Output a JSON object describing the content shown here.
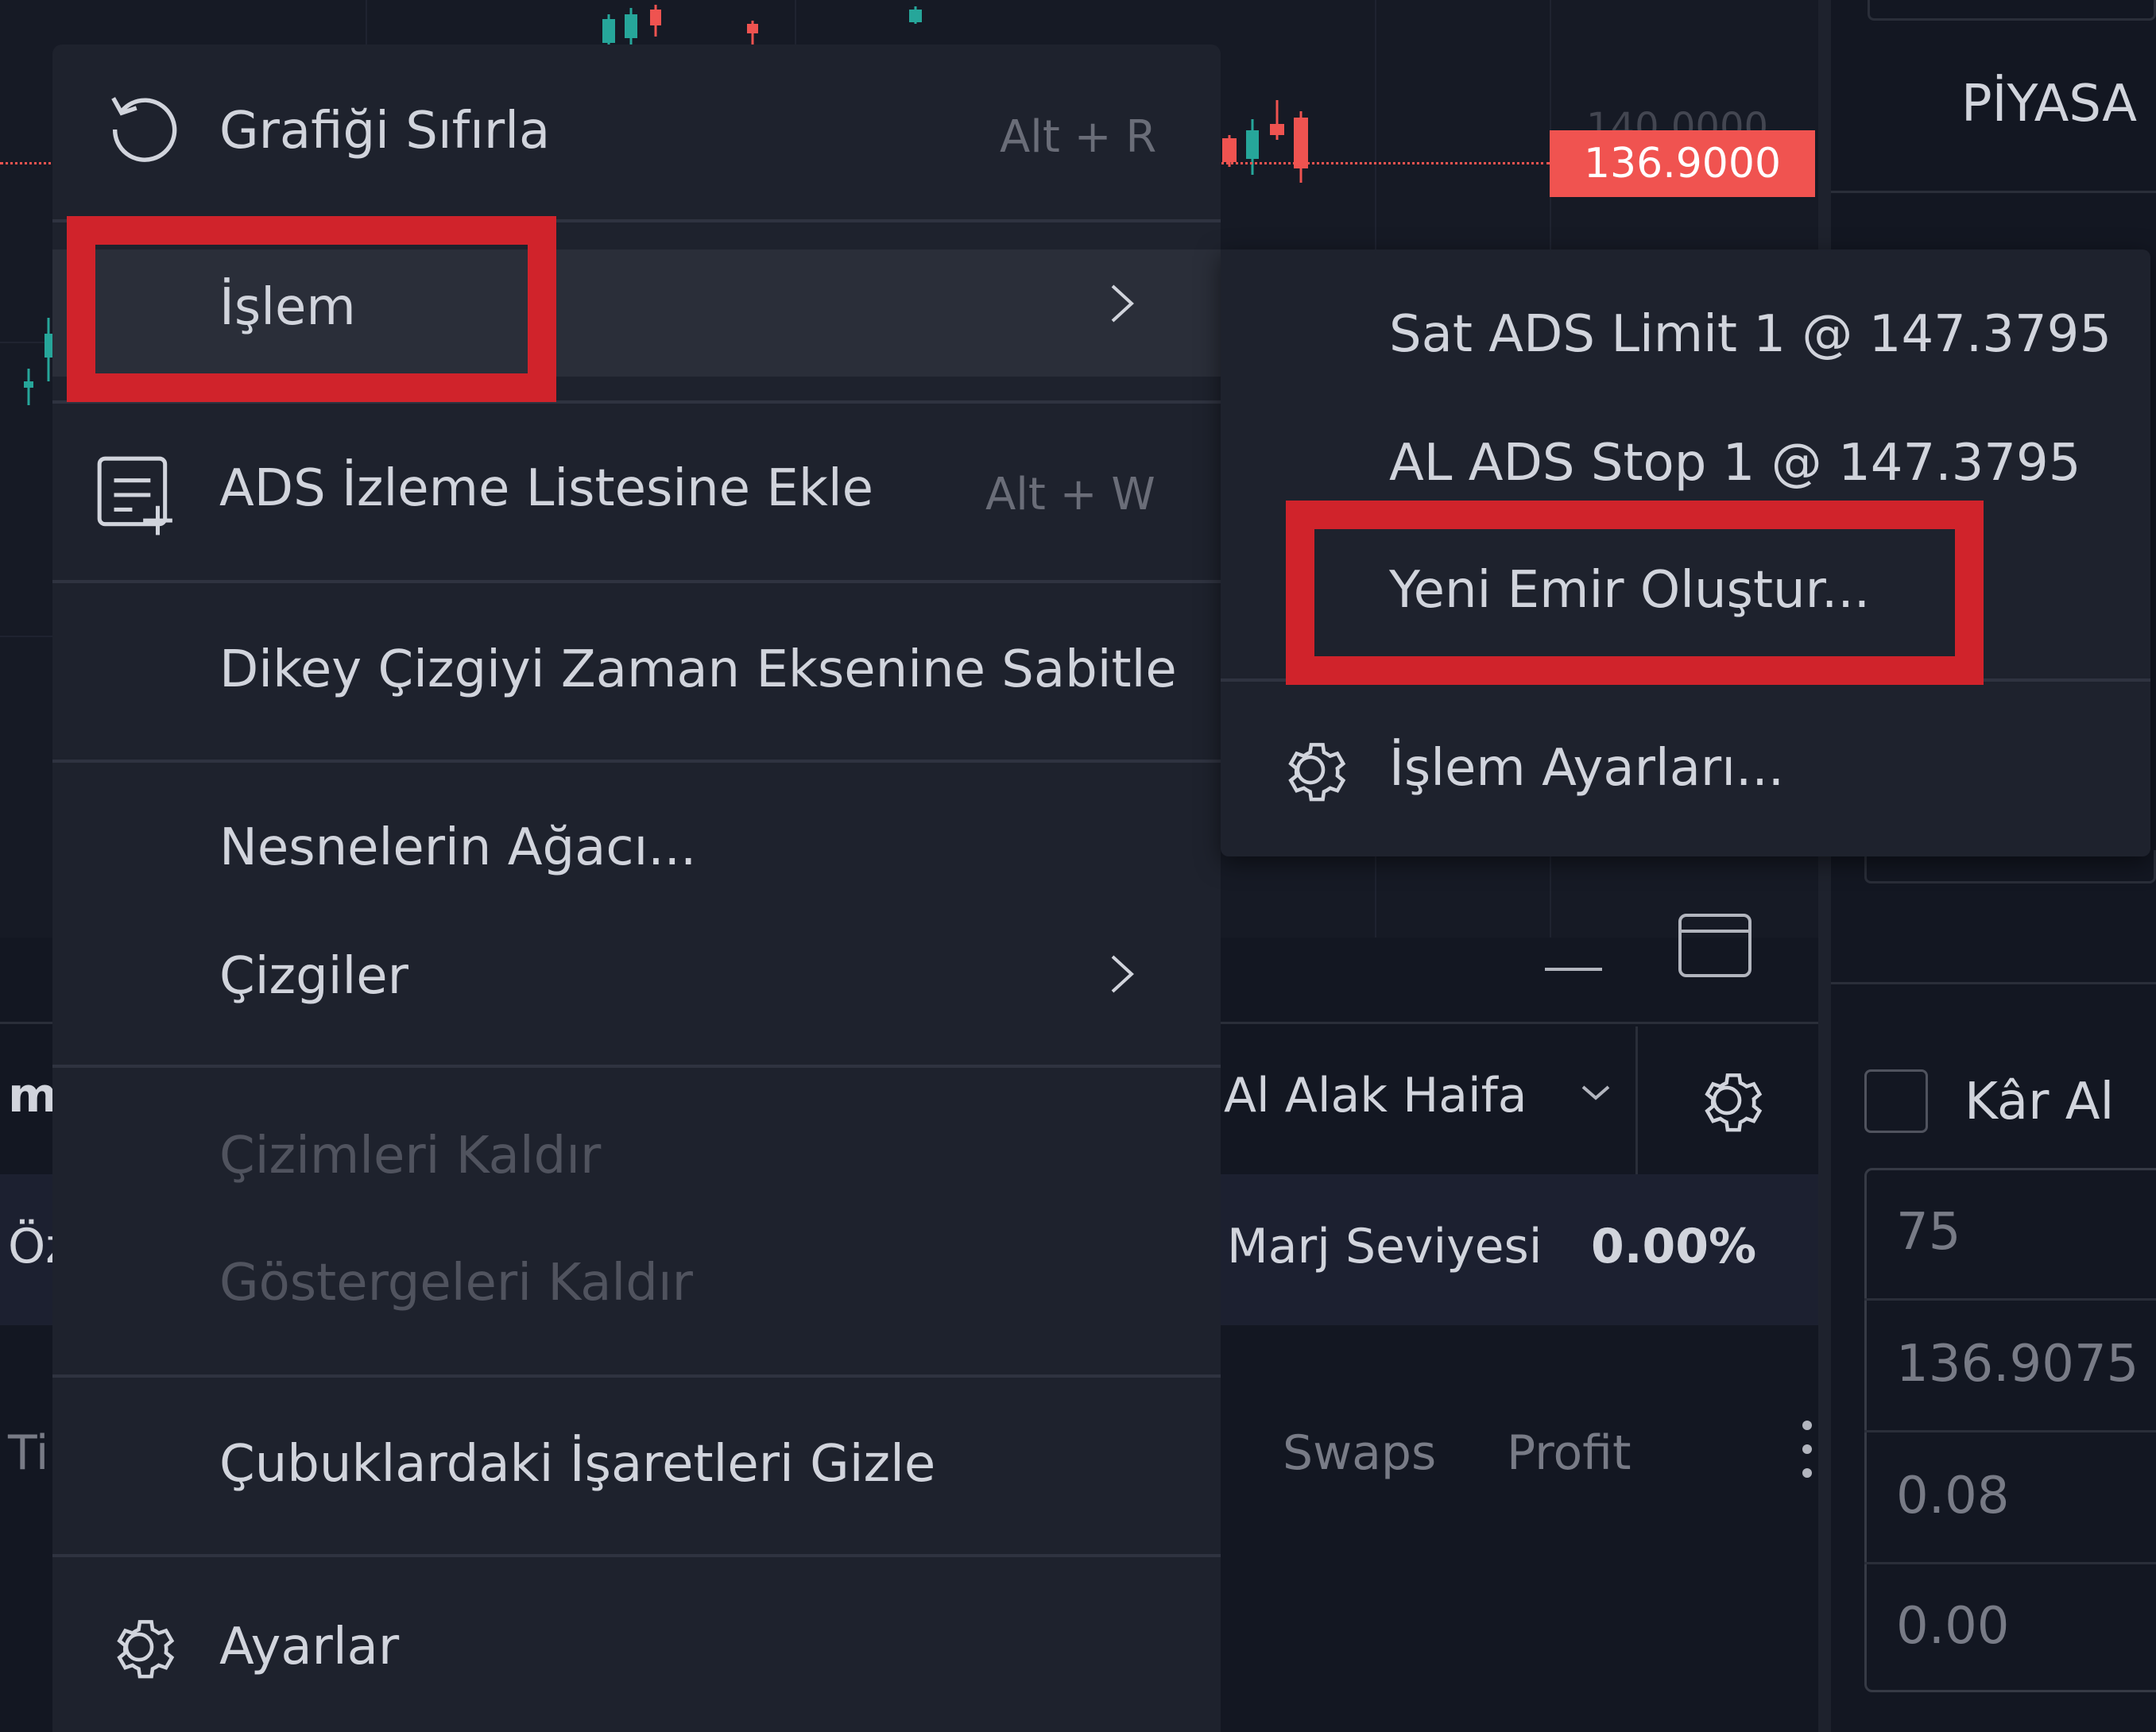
{
  "chart": {
    "price_ghost": "140.0000",
    "price_tag": "136.9000",
    "colors": {
      "bull": "#26a69a",
      "bear": "#ef5350",
      "price_tag_bg": "#f05350"
    }
  },
  "context_menu": {
    "items": [
      {
        "label": "Grafiği Sıfırla",
        "hotkey": "Alt + R",
        "icon": "reset-icon"
      },
      {
        "label": "İşlem",
        "submenu": true
      },
      {
        "label": "ADS İzleme Listesine Ekle",
        "hotkey": "Alt + W",
        "icon": "watchlist-add-icon"
      },
      {
        "label": "Dikey Çizgiyi Zaman Eksenine Sabitle"
      },
      {
        "label": "Nesnelerin Ağacı..."
      },
      {
        "label": "Çizgiler",
        "submenu": true
      },
      {
        "label": "Çizimleri Kaldır",
        "disabled": true
      },
      {
        "label": "Göstergeleri Kaldır",
        "disabled": true
      },
      {
        "label": "Çubuklardaki İşaretleri Gizle"
      },
      {
        "label": "Ayarlar",
        "icon": "gear-icon"
      }
    ]
  },
  "submenu": {
    "items": [
      {
        "label": "Sat ADS Limit 1 @ 147.3795"
      },
      {
        "label": "AL ADS Stop 1 @ 147.3795"
      },
      {
        "label": "Yeni Emir Oluştur..."
      },
      {
        "label": "İşlem Ayarları...",
        "icon": "gear-icon"
      }
    ]
  },
  "bottom_panel": {
    "account_name": "Al Alak Haifa",
    "margin_label": "Marj Seviyesi",
    "margin_value": "0.00%",
    "columns": [
      "Swaps",
      "Profit"
    ],
    "left_fragments": [
      "ml",
      "Öz",
      "Ti"
    ]
  },
  "order_panel": {
    "market_tab": "PİYASA",
    "take_profit_label": "Kâr Al",
    "values": [
      "75",
      "136.9075",
      "0.08",
      "0.00"
    ]
  },
  "highlight_color": "#d0232b"
}
